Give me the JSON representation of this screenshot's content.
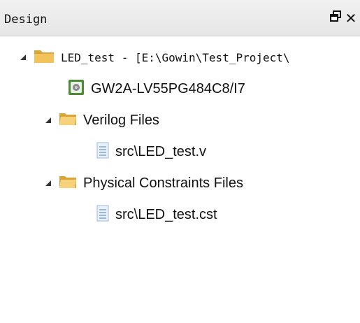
{
  "panel": {
    "title": "Design",
    "float_icon": "float-window-icon",
    "close_icon": "close-icon",
    "float_glyph": "🗗",
    "close_glyph": "✕"
  },
  "tree": {
    "project": {
      "label": "LED_test - [E:\\Gowin\\Test_Project\\",
      "icon": "project-folder-icon",
      "expanded": true
    },
    "device": {
      "label": "GW2A-LV55PG484C8/I7",
      "icon": "chip-icon"
    },
    "verilog_folder": {
      "label": "Verilog Files",
      "icon": "folder-icon",
      "expanded": true
    },
    "verilog_file": {
      "label": "src\\LED_test.v",
      "icon": "file-icon"
    },
    "constraints_folder": {
      "label": "Physical Constraints Files",
      "icon": "folder-icon",
      "expanded": true
    },
    "constraints_file": {
      "label": "src\\LED_test.cst",
      "icon": "file-icon"
    }
  },
  "colors": {
    "folder": "#f2c35a",
    "folder_dark": "#d9a43a",
    "chip": "#4e8a3a",
    "file": "#9ab7e0"
  }
}
